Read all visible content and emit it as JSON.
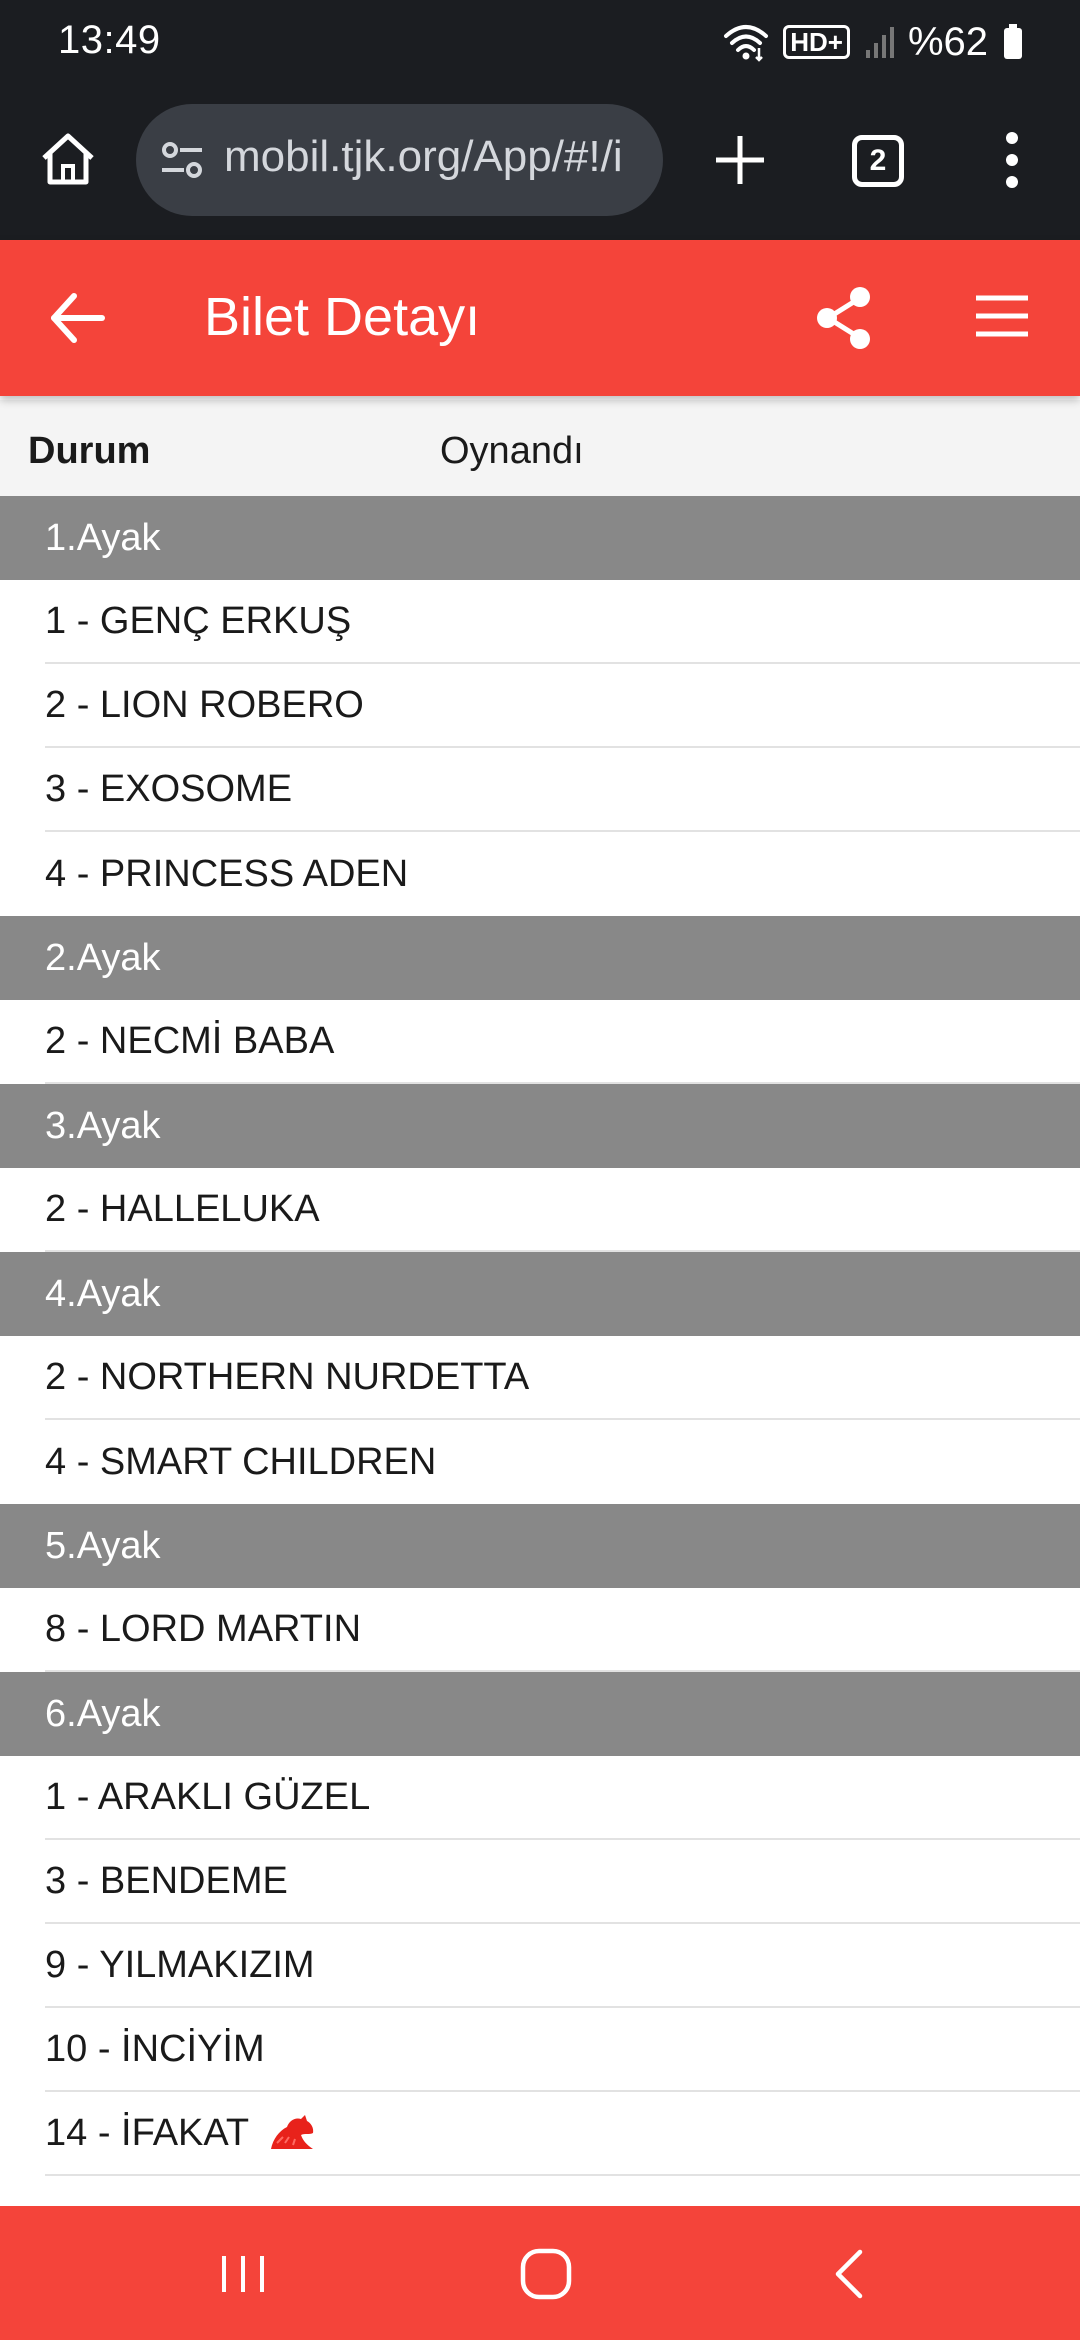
{
  "status_bar": {
    "time": "13:49",
    "battery": "%62",
    "network_label": "HD+",
    "icons": [
      "wifi-icon",
      "hd-plus-icon",
      "signal-icon",
      "battery-icon"
    ]
  },
  "browser": {
    "url": "mobil.tjk.org/App/#!/i",
    "tab_count": "2",
    "icons": [
      "home-icon",
      "tune-icon",
      "plus-icon",
      "more-vertical-icon"
    ]
  },
  "header": {
    "title": "Bilet Detayı",
    "background": "#f4443a",
    "icons": [
      "arrow-left-icon",
      "share-icon",
      "hamburger-menu-icon"
    ]
  },
  "status": {
    "label": "Durum",
    "value": "Oynandı"
  },
  "legs": [
    {
      "name": "1.Ayak",
      "horses": [
        "1 - GENÇ ERKUŞ",
        "2 - LION ROBERO",
        "3 - EXOSOME",
        "4 - PRINCESS ADEN"
      ]
    },
    {
      "name": "2.Ayak",
      "horses": [
        "2 - NECMİ BABA"
      ]
    },
    {
      "name": "3.Ayak",
      "horses": [
        "2 - HALLELUKA"
      ]
    },
    {
      "name": "4.Ayak",
      "horses": [
        "2 - NORTHERN NURDETTA",
        "4 - SMART CHILDREN"
      ]
    },
    {
      "name": "5.Ayak",
      "horses": [
        "8 - LORD MARTIN"
      ]
    },
    {
      "name": "6.Ayak",
      "horses": [
        "1 - ARAKLI GÜZEL",
        "3 - BENDEME",
        "9 - YILMAKIZIM",
        "10 - İNCİYİM",
        "14 - İFAKAT"
      ]
    }
  ],
  "winner_marker_icon": "red-horse-head-icon",
  "nav_bar": {
    "icons": [
      "recent-apps-icon",
      "home-circle-icon",
      "back-chevron-icon"
    ],
    "background": "#f4443a"
  }
}
